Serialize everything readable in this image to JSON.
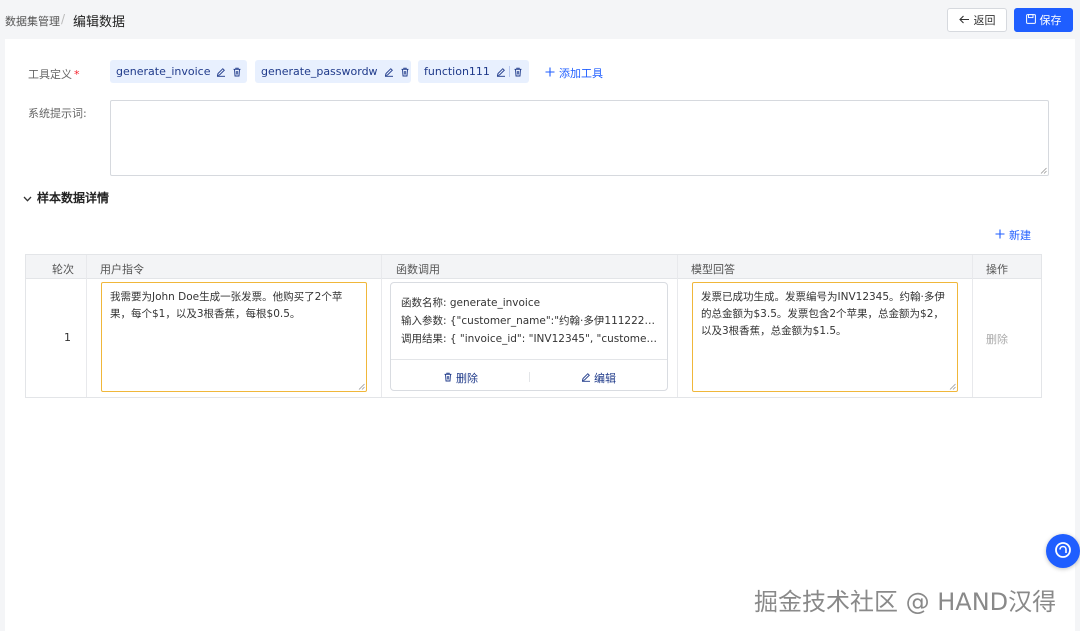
{
  "breadcrumb": {
    "root": "数据集管理",
    "separator": "/",
    "current": "编辑数据"
  },
  "actions": {
    "back_label": "返回",
    "save_label": "保存"
  },
  "form": {
    "tools_label": "工具定义",
    "required_mark": "*",
    "tools": [
      {
        "name": "generate_invoice"
      },
      {
        "name": "generate_passwordw"
      },
      {
        "name": "function111"
      }
    ],
    "add_tool_label": "添加工具",
    "system_prompt_label": "系统提示词:",
    "system_prompt_value": ""
  },
  "samples": {
    "section_title": "样本数据详情",
    "add_new_label": "新建",
    "columns": [
      "轮次",
      "用户指令",
      "函数调用",
      "模型回答",
      "操作"
    ],
    "rows": [
      {
        "round": "1",
        "user_instruction": "我需要为John Doe生成一张发票。他购买了2个苹果，每个$1，以及3根香蕉，每根$0.5。",
        "function_call": {
          "name_line": "函数名称: generate_invoice",
          "params_line": "输入参数: {\"customer_name\":\"约翰·多伊111222\",\"i...",
          "result_line": "调用结果: { \"invoice_id\": \"INV12345\", \"customer_...",
          "delete_label": "删除",
          "edit_label": "编辑"
        },
        "model_answer": "发票已成功生成。发票编号为INV12345。约翰·多伊的总金额为$3.5。发票包含2个苹果，总金额为$2，以及3根香蕉，总金额为$1.5。",
        "op_label": "删除"
      }
    ]
  },
  "watermark": "掘金技术社区 @ HAND汉得",
  "colors": {
    "primary": "#1f5eff",
    "chip_bg": "#e8f0fe",
    "focus_border": "#f0b73a",
    "required": "#f5222d"
  }
}
